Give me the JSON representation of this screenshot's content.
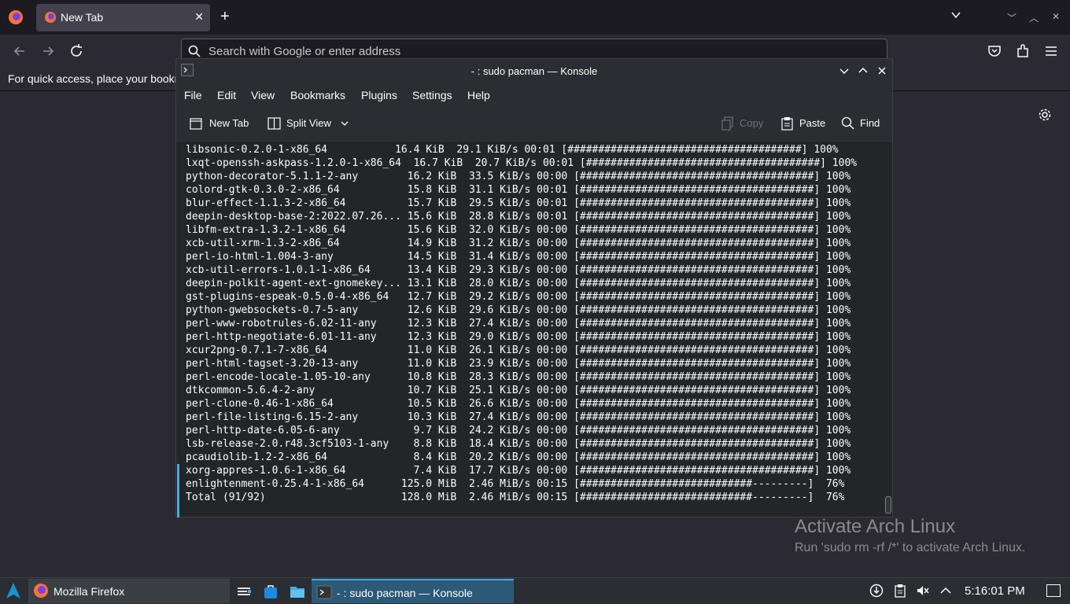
{
  "firefox": {
    "tab_title": "New Tab",
    "url_placeholder": "Search with Google or enter address",
    "bookmarks_hint": "For quick access, place your bookmarks here on the bookmarks toolbar."
  },
  "konsole": {
    "title": "- : sudo pacman — Konsole",
    "menu": [
      "File",
      "Edit",
      "View",
      "Bookmarks",
      "Plugins",
      "Settings",
      "Help"
    ],
    "toolbar": {
      "new_tab": "New Tab",
      "split_view": "Split View",
      "copy": "Copy",
      "paste": "Paste",
      "find": "Find"
    },
    "lines": [
      "libsonic-0.2.0-1-x86_64           16.4 KiB  29.1 KiB/s 00:01 [######################################] 100%",
      "lxqt-openssh-askpass-1.2.0-1-x86_64  16.7 KiB  20.7 KiB/s 00:01 [######################################] 100%",
      "python-decorator-5.1.1-2-any        16.2 KiB  33.5 KiB/s 00:00 [######################################] 100%",
      "colord-gtk-0.3.0-2-x86_64           15.8 KiB  31.1 KiB/s 00:01 [######################################] 100%",
      "blur-effect-1.1.3-2-x86_64          15.7 KiB  29.5 KiB/s 00:01 [######################################] 100%",
      "deepin-desktop-base-2:2022.07.26... 15.6 KiB  28.8 KiB/s 00:01 [######################################] 100%",
      "libfm-extra-1.3.2-1-x86_64          15.6 KiB  32.0 KiB/s 00:00 [######################################] 100%",
      "xcb-util-xrm-1.3-2-x86_64           14.9 KiB  31.2 KiB/s 00:00 [######################################] 100%",
      "perl-io-html-1.004-3-any            14.5 KiB  31.4 KiB/s 00:00 [######################################] 100%",
      "xcb-util-errors-1.0.1-1-x86_64      13.4 KiB  29.3 KiB/s 00:00 [######################################] 100%",
      "deepin-polkit-agent-ext-gnomekey... 13.1 KiB  28.0 KiB/s 00:00 [######################################] 100%",
      "gst-plugins-espeak-0.5.0-4-x86_64   12.7 KiB  29.2 KiB/s 00:00 [######################################] 100%",
      "python-gwebsockets-0.7-5-any        12.6 KiB  29.6 KiB/s 00:00 [######################################] 100%",
      "perl-www-robotrules-6.02-11-any     12.3 KiB  27.4 KiB/s 00:00 [######################################] 100%",
      "perl-http-negotiate-6.01-11-any     12.3 KiB  29.0 KiB/s 00:00 [######################################] 100%",
      "xcur2png-0.7.1-7-x86_64             11.0 KiB  26.1 KiB/s 00:00 [######################################] 100%",
      "perl-html-tagset-3.20-13-any        11.0 KiB  23.9 KiB/s 00:00 [######################################] 100%",
      "perl-encode-locale-1.05-10-any      10.8 KiB  28.3 KiB/s 00:00 [######################################] 100%",
      "dtkcommon-5.6.4-2-any               10.7 KiB  25.1 KiB/s 00:00 [######################################] 100%",
      "perl-clone-0.46-1-x86_64            10.5 KiB  26.6 KiB/s 00:00 [######################################] 100%",
      "perl-file-listing-6.15-2-any        10.3 KiB  27.4 KiB/s 00:00 [######################################] 100%",
      "perl-http-date-6.05-6-any            9.7 KiB  24.2 KiB/s 00:00 [######################################] 100%",
      "lsb-release-2.0.r48.3cf5103-1-any    8.8 KiB  18.4 KiB/s 00:00 [######################################] 100%",
      "pcaudiolib-1.2-2-x86_64              8.4 KiB  20.2 KiB/s 00:00 [######################################] 100%",
      "xorg-appres-1.0.6-1-x86_64           7.4 KiB  17.7 KiB/s 00:00 [######################################] 100%",
      "enlightenment-0.25.4-1-x86_64      125.0 MiB  2.46 MiB/s 00:15 [############################---------]  76%",
      "Total (91/92)                      128.0 MiB  2.46 MiB/s 00:15 [############################---------]  76%"
    ]
  },
  "watermark": {
    "title": "Activate Arch Linux",
    "subtitle": "Run 'sudo rm -rf /*' to activate Arch Linux."
  },
  "taskbar": {
    "firefox_label": "Mozilla Firefox",
    "konsole_label": "- : sudo pacman — Konsole",
    "clock": "5:16:01 PM"
  },
  "colors": {
    "accent": "#3daee9",
    "terminal_bg": "#232629",
    "firefox_bg": "#2b2a33"
  },
  "icons": [
    "firefox-icon",
    "close-icon",
    "plus-icon",
    "chevron-down-icon",
    "back-icon",
    "forward-icon",
    "reload-icon",
    "search-icon",
    "pocket-icon",
    "extensions-icon",
    "menu-icon",
    "gear-icon",
    "konsole-icon",
    "new-tab-icon",
    "split-view-icon",
    "copy-icon",
    "paste-icon",
    "find-icon",
    "arch-icon",
    "taskview-icon",
    "store-icon",
    "folder-icon",
    "update-icon",
    "clipboard-icon",
    "mute-icon",
    "tray-expand-icon"
  ]
}
